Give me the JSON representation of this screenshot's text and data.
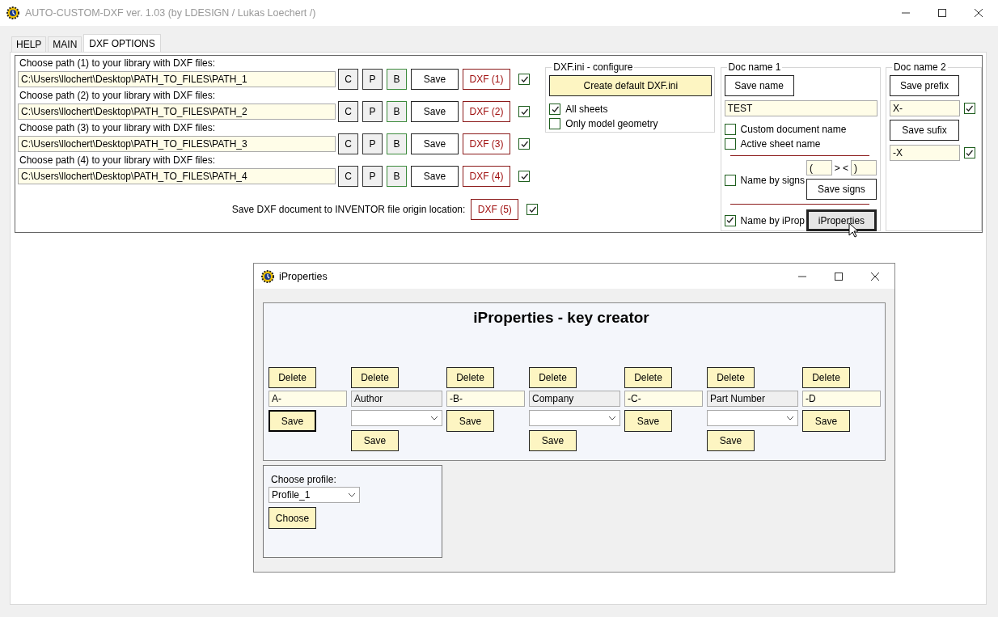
{
  "window": {
    "title": "AUTO-CUSTOM-DXF ver. 1.03 (by LDESIGN / Lukas Loechert /)"
  },
  "tabs": [
    {
      "label": "HELP",
      "selected": false
    },
    {
      "label": "MAIN",
      "selected": false
    },
    {
      "label": "DXF OPTIONS",
      "selected": true
    }
  ],
  "paths": [
    {
      "label": "Choose path (1) to your library with DXF files:",
      "value": "C:\\Users\\llochert\\Desktop\\PATH_TO_FILES\\PATH_1",
      "buttons": [
        "C",
        "P",
        "B"
      ],
      "save": "Save",
      "dxf": "DXF (1)",
      "checked": true
    },
    {
      "label": "Choose path (2) to your library with DXF files:",
      "value": "C:\\Users\\llochert\\Desktop\\PATH_TO_FILES\\PATH_2",
      "buttons": [
        "C",
        "P",
        "B"
      ],
      "save": "Save",
      "dxf": "DXF (2)",
      "checked": true
    },
    {
      "label": "Choose path (3) to your library with DXF files:",
      "value": "C:\\Users\\llochert\\Desktop\\PATH_TO_FILES\\PATH_3",
      "buttons": [
        "C",
        "P",
        "B"
      ],
      "save": "Save",
      "dxf": "DXF (3)",
      "checked": true
    },
    {
      "label": "Choose path (4) to your library with DXF files:",
      "value": "C:\\Users\\llochert\\Desktop\\PATH_TO_FILES\\PATH_4",
      "buttons": [
        "C",
        "P",
        "B"
      ],
      "save": "Save",
      "dxf": "DXF (4)",
      "checked": true
    }
  ],
  "origin": {
    "label": "Save DXF document to INVENTOR file origin location:",
    "dxf": "DXF (5)",
    "checked": true
  },
  "dxf_ini": {
    "title": "DXF.ini - configure",
    "button": "Create default DXF.ini",
    "options": [
      {
        "label": "All sheets",
        "checked": true
      },
      {
        "label": "Only model geometry",
        "checked": false
      }
    ]
  },
  "doc_name_1": {
    "title": "Doc name 1",
    "save_button": "Save name",
    "value": "TEST",
    "options": [
      {
        "label": "Custom document name",
        "checked": false
      },
      {
        "label": "Active sheet name",
        "checked": false
      }
    ],
    "name_by_signs": {
      "label": "Name by signs",
      "checked": false,
      "left": "(",
      "separator": "> <",
      "right": ")",
      "button": "Save signs"
    },
    "name_by_iprop": {
      "label": "Name by iProp",
      "checked": true,
      "button": "iProperties"
    }
  },
  "doc_name_2": {
    "title": "Doc name 2",
    "prefix_button": "Save prefix",
    "prefix": "X-",
    "prefix_checked": true,
    "suffix_button": "Save sufix",
    "suffix": "-X",
    "suffix_checked": true
  },
  "dialog": {
    "title": "iProperties",
    "heading": "iProperties - key creator",
    "columns": [
      {
        "kind": "text",
        "delete": "Delete",
        "value": "A-",
        "save": "Save",
        "focused": true
      },
      {
        "kind": "property",
        "delete": "Delete",
        "value": "Author",
        "save": "Save"
      },
      {
        "kind": "text",
        "delete": "Delete",
        "value": "-B-",
        "save": "Save",
        "focused": false
      },
      {
        "kind": "property",
        "delete": "Delete",
        "value": "Company",
        "save": "Save"
      },
      {
        "kind": "text",
        "delete": "Delete",
        "value": "-C-",
        "save": "Save",
        "focused": false
      },
      {
        "kind": "property",
        "delete": "Delete",
        "value": "Part Number",
        "save": "Save"
      },
      {
        "kind": "text",
        "delete": "Delete",
        "value": "-D",
        "save": "Save",
        "focused": false
      }
    ],
    "profile": {
      "label": "Choose profile:",
      "value": "Profile_1",
      "button": "Choose"
    }
  }
}
